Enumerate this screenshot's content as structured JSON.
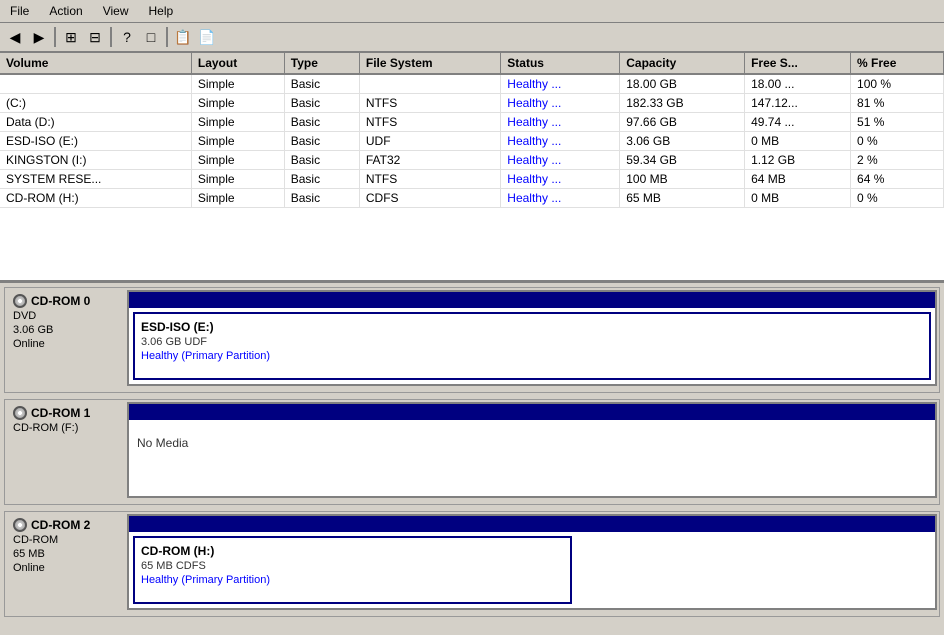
{
  "menu": {
    "items": [
      "File",
      "Action",
      "View",
      "Help"
    ]
  },
  "toolbar": {
    "buttons": [
      "←",
      "→",
      "⊞",
      "⊟",
      "?",
      "□",
      "📄",
      "🖹"
    ]
  },
  "table": {
    "columns": [
      "Volume",
      "Layout",
      "Type",
      "File System",
      "Status",
      "Capacity",
      "Free S...",
      "% Free"
    ],
    "rows": [
      {
        "volume": "",
        "layout": "Simple",
        "type": "Basic",
        "filesystem": "",
        "status": "Healthy ...",
        "capacity": "18.00 GB",
        "free": "18.00 ...",
        "pctfree": "100 %"
      },
      {
        "volume": "(C:)",
        "layout": "Simple",
        "type": "Basic",
        "filesystem": "NTFS",
        "status": "Healthy ...",
        "capacity": "182.33 GB",
        "free": "147.12...",
        "pctfree": "81 %"
      },
      {
        "volume": "Data (D:)",
        "layout": "Simple",
        "type": "Basic",
        "filesystem": "NTFS",
        "status": "Healthy ...",
        "capacity": "97.66 GB",
        "free": "49.74 ...",
        "pctfree": "51 %"
      },
      {
        "volume": "ESD-ISO (E:)",
        "layout": "Simple",
        "type": "Basic",
        "filesystem": "UDF",
        "status": "Healthy ...",
        "capacity": "3.06 GB",
        "free": "0 MB",
        "pctfree": "0 %"
      },
      {
        "volume": "KINGSTON (I:)",
        "layout": "Simple",
        "type": "Basic",
        "filesystem": "FAT32",
        "status": "Healthy ...",
        "capacity": "59.34 GB",
        "free": "1.12 GB",
        "pctfree": "2 %"
      },
      {
        "volume": "SYSTEM RESE...",
        "layout": "Simple",
        "type": "Basic",
        "filesystem": "NTFS",
        "status": "Healthy ...",
        "capacity": "100 MB",
        "free": "64 MB",
        "pctfree": "64 %"
      },
      {
        "volume": "CD-ROM (H:)",
        "layout": "Simple",
        "type": "Basic",
        "filesystem": "CDFS",
        "status": "Healthy ...",
        "capacity": "65 MB",
        "free": "0 MB",
        "pctfree": "0 %"
      }
    ]
  },
  "disks": [
    {
      "id": "cd-rom-0",
      "label": "CD-ROM 0",
      "type": "DVD",
      "size": "3.06 GB",
      "status": "Online",
      "partitions": [
        {
          "title": "ESD-ISO  (E:)",
          "info": "3.06 GB UDF",
          "status": "Healthy (Primary Partition)",
          "selected": true,
          "widthPct": 100
        }
      ],
      "noMedia": false
    },
    {
      "id": "cd-rom-1",
      "label": "CD-ROM 1",
      "type": "CD-ROM (F:)",
      "size": "",
      "status": "",
      "partitions": [],
      "noMedia": true,
      "noMediaText": "No Media"
    },
    {
      "id": "cd-rom-2",
      "label": "CD-ROM 2",
      "type": "CD-ROM",
      "size": "65 MB",
      "status": "Online",
      "partitions": [
        {
          "title": "CD-ROM  (H:)",
          "info": "65 MB CDFS",
          "status": "Healthy (Primary Partition)",
          "selected": false,
          "widthPct": 55
        }
      ],
      "noMedia": false
    }
  ]
}
